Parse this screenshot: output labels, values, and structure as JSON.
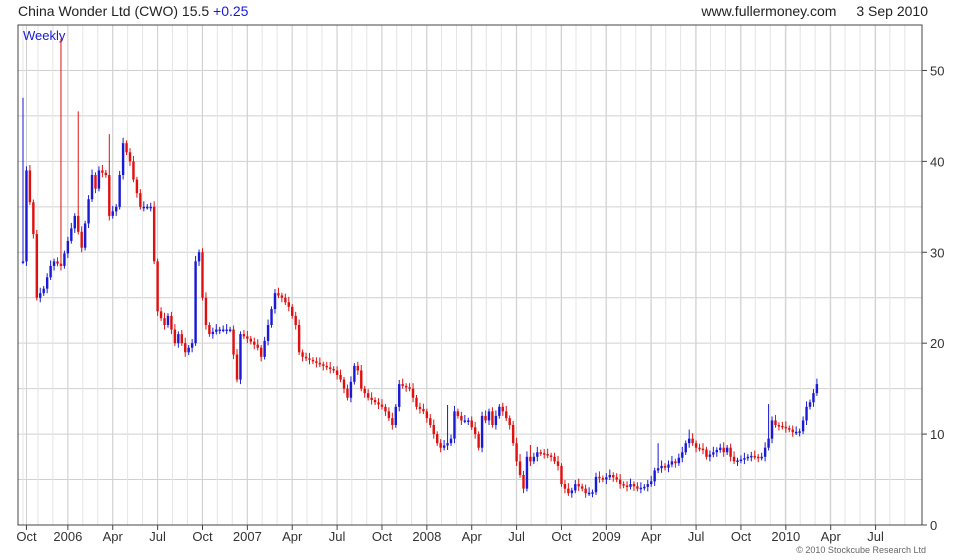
{
  "header": {
    "title": "China Wonder Ltd (CWO)",
    "price": "15.5",
    "change": "+0.25",
    "website": "www.fullermoney.com",
    "date": "3 Sep 2010"
  },
  "footer": {
    "copyright": "© 2010 Stockcube Research Ltd"
  },
  "colors": {
    "up": "#1a1ad6",
    "down": "#e01010",
    "grid": "#d0d0d0",
    "frame": "#444444"
  },
  "chart_data": {
    "type": "candlestick",
    "period_label": "Weekly",
    "x_ticks": [
      "Oct",
      "2006",
      "Apr",
      "Jul",
      "Oct",
      "2007",
      "Apr",
      "Jul",
      "Oct",
      "2008",
      "Apr",
      "Jul",
      "Oct",
      "2009",
      "Apr",
      "Jul",
      "Oct",
      "2010",
      "Apr",
      "Jul"
    ],
    "x_tick_weeks": [
      1,
      13,
      26,
      39,
      52,
      65,
      78,
      91,
      104,
      117,
      130,
      143,
      156,
      169,
      182,
      195,
      208,
      221,
      234,
      247
    ],
    "y_ticks": [
      0,
      10,
      20,
      30,
      40,
      50
    ],
    "ylim": [
      0,
      55
    ],
    "total_weeks": 259,
    "grid": true,
    "close_path": [
      [
        0,
        29
      ],
      [
        1,
        39
      ],
      [
        3,
        32
      ],
      [
        4,
        25
      ],
      [
        6,
        26
      ],
      [
        8,
        28.5
      ],
      [
        9,
        29
      ],
      [
        11,
        28.5
      ],
      [
        15,
        34
      ],
      [
        17,
        30.5
      ],
      [
        20,
        38.5
      ],
      [
        21,
        37
      ],
      [
        22,
        39
      ],
      [
        24,
        38.5
      ],
      [
        25,
        34
      ],
      [
        27,
        35
      ],
      [
        29,
        42
      ],
      [
        30,
        41
      ],
      [
        31,
        40
      ],
      [
        32,
        38
      ],
      [
        34,
        35
      ],
      [
        37,
        35
      ],
      [
        38,
        29
      ],
      [
        39,
        23.5
      ],
      [
        41,
        22
      ],
      [
        42,
        23
      ],
      [
        44,
        20
      ],
      [
        45,
        21
      ],
      [
        47,
        19
      ],
      [
        49,
        20
      ],
      [
        50,
        29
      ],
      [
        51,
        30
      ],
      [
        52,
        25
      ],
      [
        53,
        22
      ],
      [
        54,
        21
      ],
      [
        56,
        21.5
      ],
      [
        60,
        21.5
      ],
      [
        62,
        16
      ],
      [
        63,
        21
      ],
      [
        65,
        20.5
      ],
      [
        68,
        19.5
      ],
      [
        69,
        18.5
      ],
      [
        71,
        22
      ],
      [
        73,
        25.5
      ],
      [
        75,
        25
      ],
      [
        77,
        24
      ],
      [
        79,
        22
      ],
      [
        80,
        19
      ],
      [
        81,
        18.5
      ],
      [
        84,
        18
      ],
      [
        87,
        17.5
      ],
      [
        90,
        17
      ],
      [
        92,
        16
      ],
      [
        94,
        14
      ],
      [
        96,
        17.5
      ],
      [
        97,
        17
      ],
      [
        98,
        15
      ],
      [
        100,
        14
      ],
      [
        102,
        13.5
      ],
      [
        104,
        13
      ],
      [
        105,
        12.5
      ],
      [
        107,
        11
      ],
      [
        108,
        13
      ],
      [
        109,
        15.5
      ],
      [
        110,
        15.3
      ],
      [
        112,
        15
      ],
      [
        114,
        13
      ],
      [
        116,
        12.5
      ],
      [
        118,
        11
      ],
      [
        120,
        9
      ],
      [
        121,
        8.5
      ],
      [
        123,
        9
      ],
      [
        124,
        9.5
      ],
      [
        125,
        12.5
      ],
      [
        126,
        12
      ],
      [
        127,
        11.5
      ],
      [
        129,
        11.5
      ],
      [
        131,
        10
      ],
      [
        132,
        8.5
      ],
      [
        133,
        12
      ],
      [
        134,
        11.5
      ],
      [
        135,
        12.5
      ],
      [
        136,
        11
      ],
      [
        138,
        13
      ],
      [
        139,
        12.5
      ],
      [
        141,
        11
      ],
      [
        142,
        9
      ],
      [
        143,
        7
      ],
      [
        145,
        4
      ],
      [
        146,
        7.5
      ],
      [
        147,
        7
      ],
      [
        149,
        8
      ],
      [
        151,
        7.8
      ],
      [
        153,
        7.5
      ],
      [
        155,
        6.5
      ],
      [
        156,
        4.5
      ],
      [
        158,
        3.5
      ],
      [
        159,
        3.8
      ],
      [
        160,
        4.5
      ],
      [
        162,
        4
      ],
      [
        163,
        3.5
      ],
      [
        165,
        3.6
      ],
      [
        166,
        5.3
      ],
      [
        168,
        5
      ],
      [
        170,
        5.5
      ],
      [
        172,
        5
      ],
      [
        173,
        4.5
      ],
      [
        175,
        4.2
      ],
      [
        176,
        4.5
      ],
      [
        178,
        4
      ],
      [
        180,
        4.2
      ],
      [
        182,
        4.8
      ],
      [
        183,
        6
      ],
      [
        185,
        6.5
      ],
      [
        186,
        6.3
      ],
      [
        188,
        7
      ],
      [
        189,
        6.8
      ],
      [
        191,
        8
      ],
      [
        192,
        9
      ],
      [
        193,
        9.5
      ],
      [
        195,
        8.5
      ],
      [
        197,
        8.3
      ],
      [
        198,
        7.5
      ],
      [
        200,
        8
      ],
      [
        202,
        8.5
      ],
      [
        203,
        8
      ],
      [
        204,
        8.5
      ],
      [
        205,
        7.5
      ],
      [
        206,
        7
      ],
      [
        208,
        7.2
      ],
      [
        210,
        7.5
      ],
      [
        211,
        7.6
      ],
      [
        213,
        7.4
      ],
      [
        214,
        7.5
      ],
      [
        215,
        8.5
      ],
      [
        216,
        9.5
      ],
      [
        217,
        11.5
      ],
      [
        218,
        11
      ],
      [
        220,
        10.8
      ],
      [
        222,
        10.5
      ],
      [
        223,
        10.2
      ],
      [
        225,
        10.3
      ],
      [
        226,
        11.5
      ],
      [
        227,
        13
      ],
      [
        228,
        13.5
      ],
      [
        229,
        14.5
      ],
      [
        230,
        15.5
      ]
    ],
    "spikes": [
      [
        0,
        47
      ],
      [
        11,
        53.5
      ],
      [
        16,
        45.5
      ],
      [
        25,
        43
      ],
      [
        64,
        18.5
      ],
      [
        112,
        14
      ],
      [
        123,
        13.2
      ],
      [
        144,
        7.8
      ],
      [
        147,
        8.8
      ],
      [
        184,
        9
      ],
      [
        193,
        10.5
      ],
      [
        216,
        13.3
      ]
    ]
  }
}
